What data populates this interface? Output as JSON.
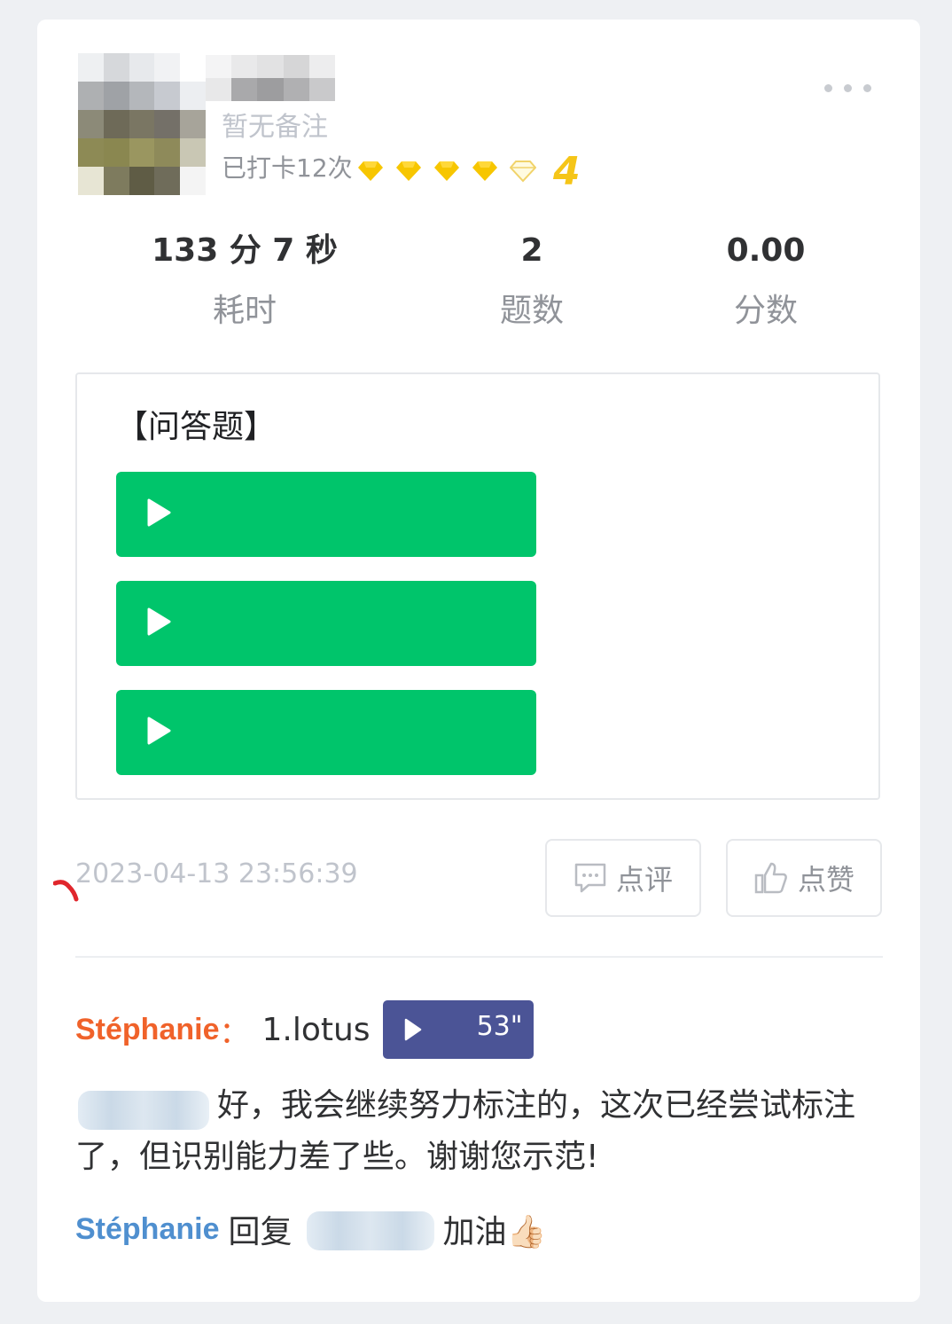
{
  "header": {
    "remark": "暂无备注",
    "checkin_text": "已打卡12次",
    "gem_icons": [
      "gem-filled",
      "gem-filled",
      "gem-filled",
      "gem-filled",
      "gem-outline"
    ],
    "level": "4",
    "more_icon": "more-dots-icon"
  },
  "stats": [
    {
      "value": "133 分 7 秒",
      "label": "耗时"
    },
    {
      "value": "2",
      "label": "题数"
    },
    {
      "value": "0.00",
      "label": "分数"
    }
  ],
  "question": {
    "title": "【问答题】",
    "audio_count": 3,
    "audio_color": "#00c56b"
  },
  "footer": {
    "timestamp": "2023-04-13 23:56:39",
    "comment_button": "点评",
    "like_button": "点赞"
  },
  "comments": [
    {
      "author": "Stéphanie",
      "separator": "：",
      "text": "1.lotus",
      "voice_duration": "53\""
    },
    {
      "text": "好，我会继续努力标注的，这次已经尝试标注了，但识别能力差了些。谢谢您示范!"
    },
    {
      "author": "Stéphanie",
      "reply_word": "回复",
      "text": "加油👍🏻"
    }
  ],
  "colors": {
    "author_orange": "#f0622a",
    "author_blue": "#4f8fcf",
    "voice_bg": "#4b5496",
    "gem_yellow": "#f7c600"
  }
}
